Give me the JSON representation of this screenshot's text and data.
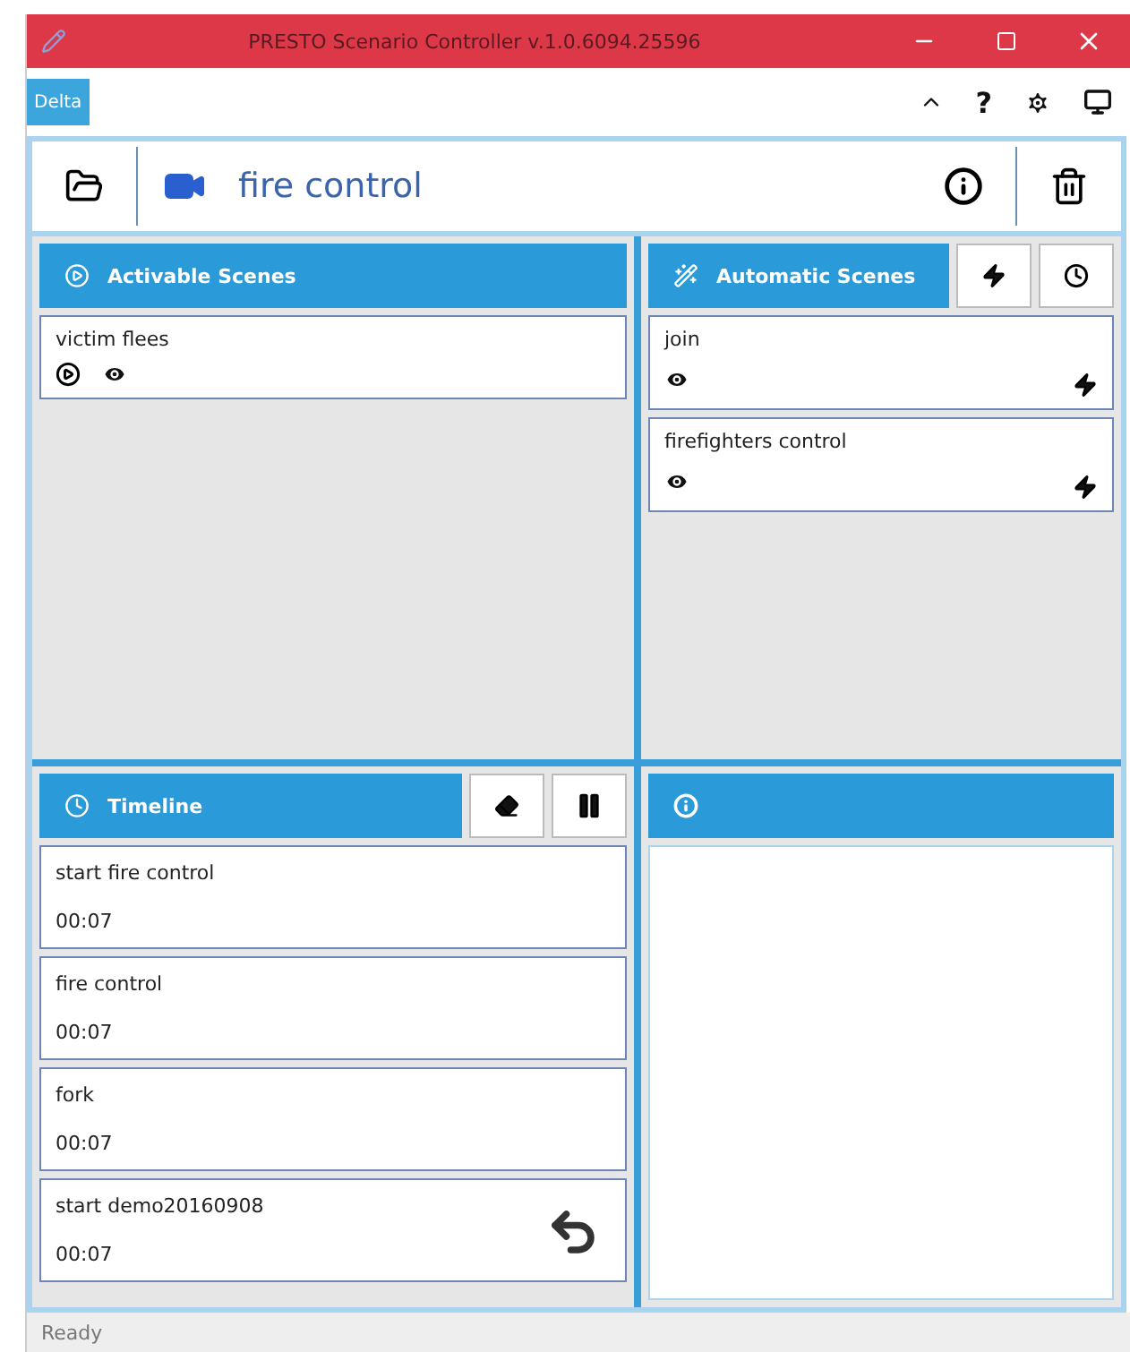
{
  "window": {
    "title": "PRESTO Scenario Controller v.1.0.6094.25596"
  },
  "logo": {
    "text": "Delta"
  },
  "toolbar": {
    "help": "?"
  },
  "scenario": {
    "name": "fire control"
  },
  "activable_scenes": {
    "title": "Activable Scenes",
    "items": [
      {
        "name": "victim flees"
      }
    ]
  },
  "automatic_scenes": {
    "title": "Automatic Scenes",
    "items": [
      {
        "name": "join"
      },
      {
        "name": "firefighters control"
      }
    ]
  },
  "timeline": {
    "title": "Timeline",
    "items": [
      {
        "name": "start fire control",
        "time": "00:07",
        "undo": false
      },
      {
        "name": "fire control",
        "time": "00:07",
        "undo": false
      },
      {
        "name": "fork",
        "time": "00:07",
        "undo": false
      },
      {
        "name": "start demo20160908",
        "time": "00:07",
        "undo": true
      }
    ]
  },
  "status_bar": {
    "text": "Ready"
  }
}
